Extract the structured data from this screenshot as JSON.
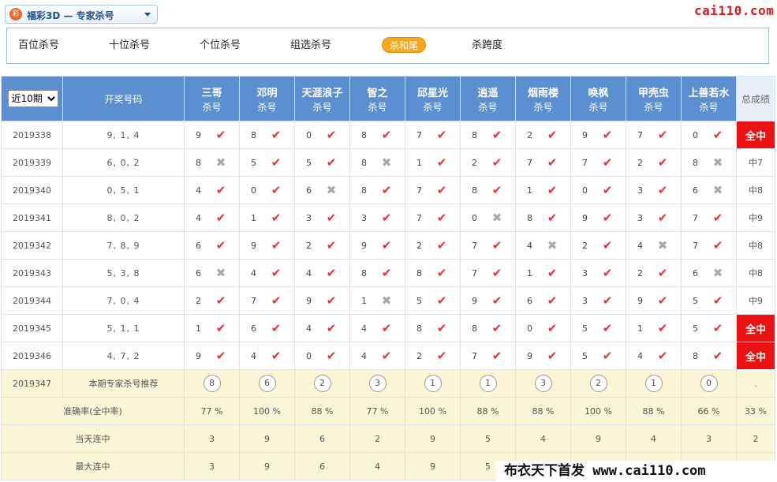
{
  "selector": {
    "logo": "彩",
    "label": "福彩3D — 专家杀号"
  },
  "site_logo": "cai110.com",
  "tabs": [
    {
      "label": "百位杀号",
      "active": false
    },
    {
      "label": "十位杀号",
      "active": false
    },
    {
      "label": "个位杀号",
      "active": false
    },
    {
      "label": "组选杀号",
      "active": false
    },
    {
      "label": "杀和尾",
      "active": true
    },
    {
      "label": "杀跨度",
      "active": false
    }
  ],
  "table": {
    "period_select": "近10期",
    "period_options": [
      "近10期"
    ],
    "draw_header": "开奖号码",
    "total_header": "总成绩",
    "expert_sub": "杀号",
    "experts": [
      "三哥",
      "邓明",
      "天涯浪子",
      "智之",
      "邱星光",
      "逍遥",
      "烟雨楼",
      "唤枫",
      "甲壳虫",
      "上善若水"
    ],
    "rows": [
      {
        "issue": "2019338",
        "draw": "9, 1, 4",
        "picks": [
          "9",
          "8",
          "0",
          "8",
          "7",
          "8",
          "2",
          "9",
          "7",
          "0"
        ],
        "ok": [
          1,
          1,
          1,
          1,
          1,
          1,
          1,
          1,
          1,
          1
        ],
        "result": "全中",
        "all": true
      },
      {
        "issue": "2019339",
        "draw": "6, 0, 2",
        "picks": [
          "8",
          "5",
          "5",
          "8",
          "1",
          "2",
          "7",
          "7",
          "2",
          "8"
        ],
        "ok": [
          0,
          1,
          1,
          0,
          1,
          1,
          1,
          1,
          1,
          0
        ],
        "result": "中7",
        "all": false
      },
      {
        "issue": "2019340",
        "draw": "0, 5, 1",
        "picks": [
          "4",
          "0",
          "6",
          "8",
          "7",
          "8",
          "1",
          "0",
          "3",
          "6"
        ],
        "ok": [
          1,
          1,
          0,
          1,
          1,
          1,
          1,
          1,
          1,
          0
        ],
        "result": "中8",
        "all": false
      },
      {
        "issue": "2019341",
        "draw": "8, 0, 2",
        "picks": [
          "4",
          "1",
          "3",
          "3",
          "7",
          "0",
          "8",
          "9",
          "3",
          "7"
        ],
        "ok": [
          1,
          1,
          1,
          1,
          1,
          0,
          1,
          1,
          1,
          1
        ],
        "result": "中9",
        "all": false
      },
      {
        "issue": "2019342",
        "draw": "7, 8, 9",
        "picks": [
          "6",
          "9",
          "2",
          "9",
          "2",
          "7",
          "4",
          "2",
          "4",
          "7"
        ],
        "ok": [
          1,
          1,
          1,
          1,
          1,
          1,
          0,
          1,
          0,
          1
        ],
        "result": "中8",
        "all": false
      },
      {
        "issue": "2019343",
        "draw": "5, 3, 8",
        "picks": [
          "6",
          "4",
          "4",
          "8",
          "8",
          "7",
          "1",
          "3",
          "2",
          "6"
        ],
        "ok": [
          0,
          1,
          1,
          1,
          1,
          1,
          1,
          1,
          1,
          0
        ],
        "result": "中8",
        "all": false
      },
      {
        "issue": "2019344",
        "draw": "7, 0, 4",
        "picks": [
          "2",
          "7",
          "9",
          "1",
          "5",
          "9",
          "6",
          "3",
          "9",
          "5"
        ],
        "ok": [
          1,
          1,
          1,
          0,
          1,
          1,
          1,
          1,
          1,
          1
        ],
        "result": "中9",
        "all": false
      },
      {
        "issue": "2019345",
        "draw": "5, 1, 1",
        "picks": [
          "1",
          "6",
          "4",
          "4",
          "8",
          "8",
          "0",
          "5",
          "1",
          "5"
        ],
        "ok": [
          1,
          1,
          1,
          1,
          1,
          1,
          1,
          1,
          1,
          1
        ],
        "result": "全中",
        "all": true
      },
      {
        "issue": "2019346",
        "draw": "4, 7, 2",
        "picks": [
          "9",
          "4",
          "0",
          "4",
          "2",
          "7",
          "9",
          "5",
          "4",
          "8"
        ],
        "ok": [
          1,
          1,
          1,
          1,
          1,
          1,
          1,
          1,
          1,
          1
        ],
        "result": "全中",
        "all": true
      }
    ],
    "recommend": {
      "issue": "2019347",
      "label": "本期专家杀号推荐",
      "picks": [
        "8",
        "6",
        "2",
        "3",
        "1",
        "1",
        "3",
        "2",
        "1",
        "0"
      ],
      "total": "."
    },
    "accuracy": {
      "label": "准确率(全中率)",
      "values": [
        "77 %",
        "100 %",
        "88 %",
        "77 %",
        "100 %",
        "88 %",
        "88 %",
        "100 %",
        "88 %",
        "66 %"
      ],
      "total": "33 %"
    },
    "today_streak": {
      "label": "当天连中",
      "values": [
        "3",
        "9",
        "6",
        "2",
        "9",
        "5",
        "4",
        "9",
        "4",
        "3"
      ],
      "total": "2"
    },
    "max_streak": {
      "label": "最大连中",
      "values": [
        "3",
        "9",
        "6",
        "4",
        "9",
        "5",
        "",
        "",
        "",
        ""
      ],
      "total": ""
    }
  },
  "watermark": "布衣天下首发 www.cai110.com"
}
